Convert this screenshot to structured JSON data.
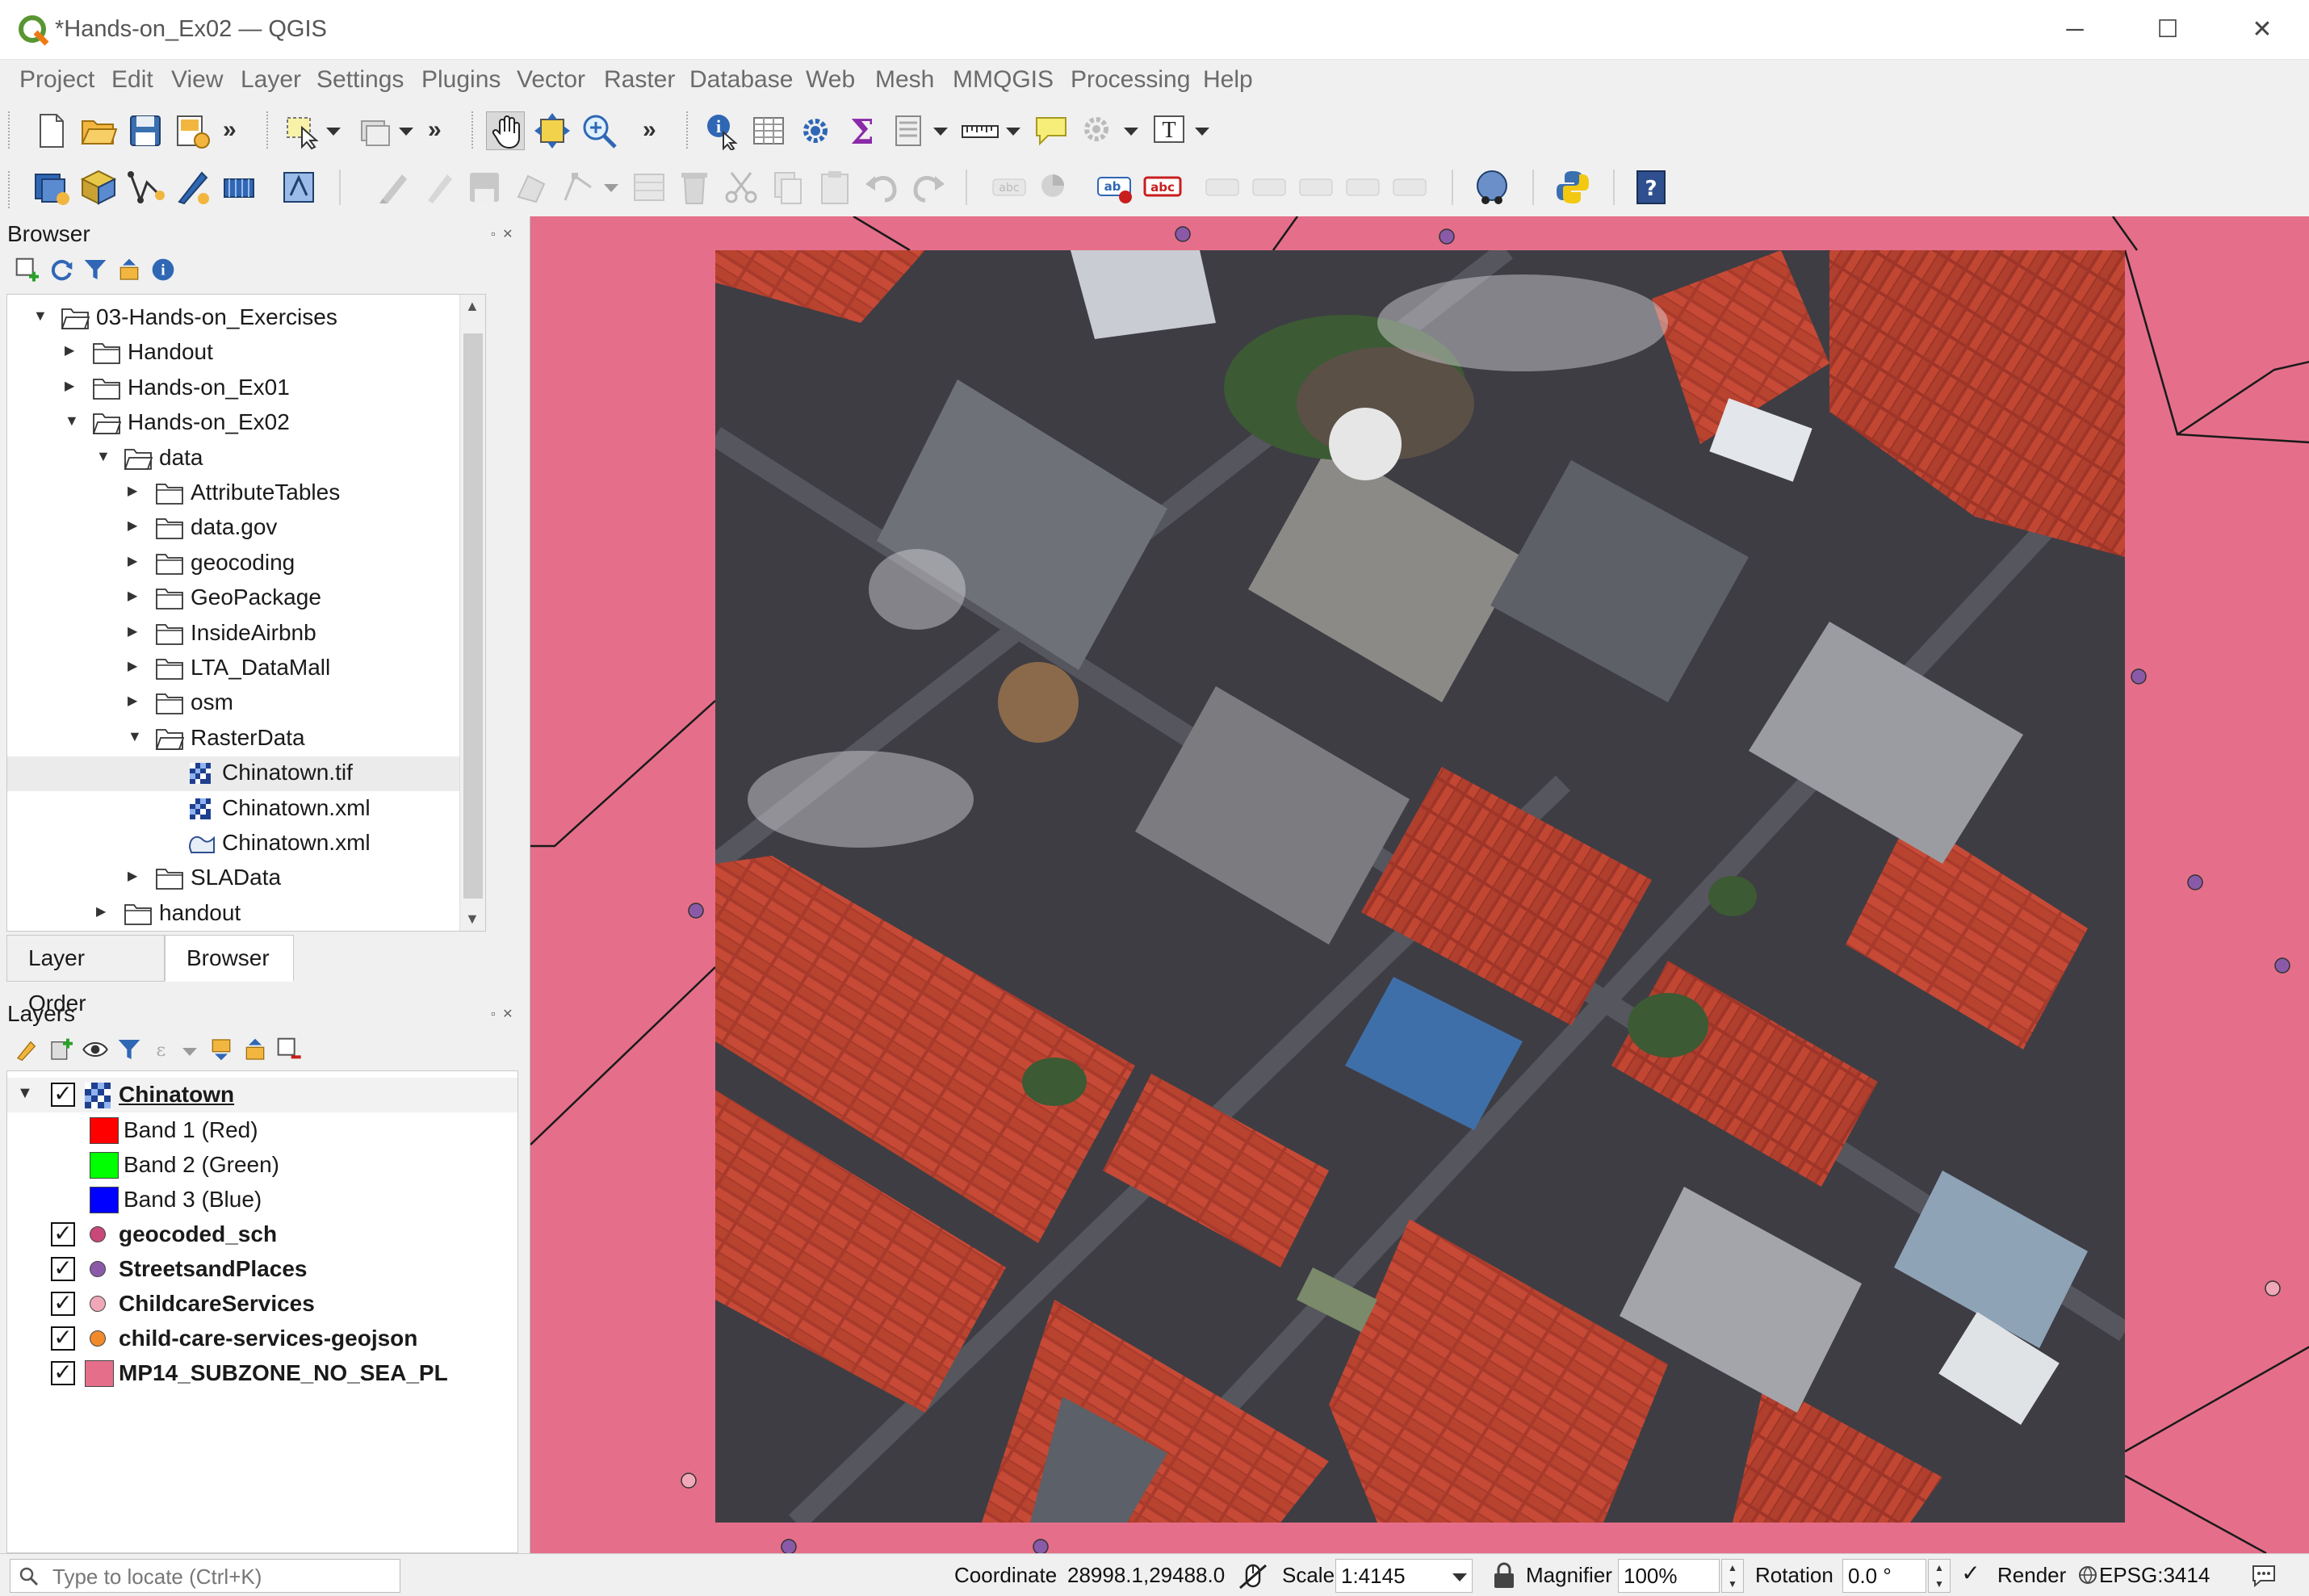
{
  "window": {
    "title": "*Hands-on_Ex02 — QGIS",
    "minimize": "─",
    "maximize": "☐",
    "close": "✕"
  },
  "menu": [
    "Project",
    "Edit",
    "View",
    "Layer",
    "Settings",
    "Plugins",
    "Vector",
    "Raster",
    "Database",
    "Web",
    "Mesh",
    "MMQGIS",
    "Processing",
    "Help"
  ],
  "toolbar": {
    "overflow": "»",
    "text_tool_glyph": "T"
  },
  "browser_panel": {
    "title": "Browser",
    "tree": [
      {
        "label": "03-Hands-on_Exercises",
        "depth": 0,
        "expanded": true,
        "icon": "folder-icon"
      },
      {
        "label": "Handout",
        "depth": 1,
        "expanded": false,
        "icon": "folder-icon"
      },
      {
        "label": "Hands-on_Ex01",
        "depth": 1,
        "expanded": false,
        "icon": "folder-icon"
      },
      {
        "label": "Hands-on_Ex02",
        "depth": 1,
        "expanded": true,
        "icon": "folder-icon"
      },
      {
        "label": "data",
        "depth": 2,
        "expanded": true,
        "icon": "folder-icon"
      },
      {
        "label": "AttributeTables",
        "depth": 3,
        "expanded": false,
        "icon": "folder-icon"
      },
      {
        "label": "data.gov",
        "depth": 3,
        "expanded": false,
        "icon": "folder-icon"
      },
      {
        "label": "geocoding",
        "depth": 3,
        "expanded": false,
        "icon": "folder-icon"
      },
      {
        "label": "GeoPackage",
        "depth": 3,
        "expanded": false,
        "icon": "folder-icon"
      },
      {
        "label": "InsideAirbnb",
        "depth": 3,
        "expanded": false,
        "icon": "folder-icon"
      },
      {
        "label": "LTA_DataMall",
        "depth": 3,
        "expanded": false,
        "icon": "folder-icon"
      },
      {
        "label": "osm",
        "depth": 3,
        "expanded": false,
        "icon": "folder-icon"
      },
      {
        "label": "RasterData",
        "depth": 3,
        "expanded": true,
        "icon": "folder-icon"
      },
      {
        "label": "Chinatown.tif",
        "depth": 4,
        "icon": "raster-icon",
        "selected": true
      },
      {
        "label": "Chinatown.xml",
        "depth": 4,
        "icon": "raster-icon"
      },
      {
        "label": "Chinatown.xml",
        "depth": 4,
        "icon": "vector-icon"
      },
      {
        "label": "SLAData",
        "depth": 3,
        "expanded": false,
        "icon": "folder-icon"
      },
      {
        "label": "handout",
        "depth": 2,
        "expanded": false,
        "icon": "folder-icon"
      }
    ]
  },
  "dock_tabs": [
    "Layer Order",
    "Browser"
  ],
  "layers_panel": {
    "title": "Layers",
    "layers": [
      {
        "name": "Chinatown",
        "checked": true,
        "type": "raster",
        "bands": [
          {
            "label": "Band 1 (Red)",
            "color": "#ff0000"
          },
          {
            "label": "Band 2 (Green)",
            "color": "#00ff00"
          },
          {
            "label": "Band 3 (Blue)",
            "color": "#0000ff"
          }
        ]
      },
      {
        "name": "geocoded_sch",
        "checked": true,
        "symbol": "dot",
        "color": "#c9487a"
      },
      {
        "name": "StreetsandPlaces",
        "checked": true,
        "symbol": "dot",
        "color": "#8a5aa8"
      },
      {
        "name": "ChildcareServices",
        "checked": true,
        "symbol": "dot",
        "color": "#f0a8b8"
      },
      {
        "name": "child-care-services-geojson",
        "checked": true,
        "symbol": "dot",
        "color": "#f08a2a"
      },
      {
        "name": "MP14_SUBZONE_NO_SEA_PL",
        "checked": true,
        "symbol": "polygon",
        "color": "#e56f8a"
      }
    ]
  },
  "statusbar": {
    "locator_placeholder": "Type to locate (Ctrl+K)",
    "coordinate_label": "Coordinate",
    "coordinate": "28998.1,29488.0",
    "scale_label": "Scale",
    "scale": "1:4145",
    "magnifier_label": "Magnifier",
    "magnifier": "100%",
    "rotation_label": "Rotation",
    "rotation": "0.0 °",
    "render_label": "Render",
    "crs": "EPSG:3414"
  },
  "colors": {
    "subzone_fill": "#e56f8a",
    "point_purple": "#8a5aa8",
    "point_pink": "#f0a8b8",
    "roof_red": "#b5402f"
  }
}
